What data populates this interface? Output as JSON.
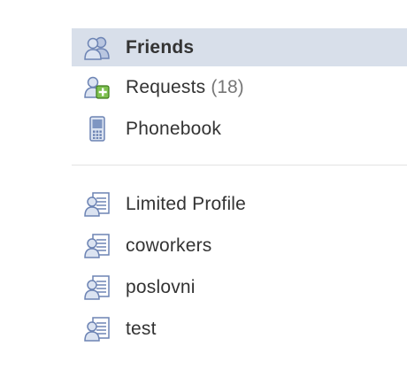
{
  "nav": {
    "friends": {
      "label": "Friends",
      "icon": "friends-icon"
    },
    "requests": {
      "label": "Requests",
      "count": "(18)",
      "icon": "friend-request-icon"
    },
    "phonebook": {
      "label": "Phonebook",
      "icon": "phone-icon"
    }
  },
  "lists": [
    {
      "label": "Limited Profile",
      "icon": "friend-list-icon"
    },
    {
      "label": "coworkers",
      "icon": "friend-list-icon"
    },
    {
      "label": "poslovni",
      "icon": "friend-list-icon"
    },
    {
      "label": "test",
      "icon": "friend-list-icon"
    }
  ],
  "colors": {
    "selected_bg": "#d8dfea",
    "icon_blue": "#6d84b4",
    "icon_green": "#5aa02c"
  }
}
